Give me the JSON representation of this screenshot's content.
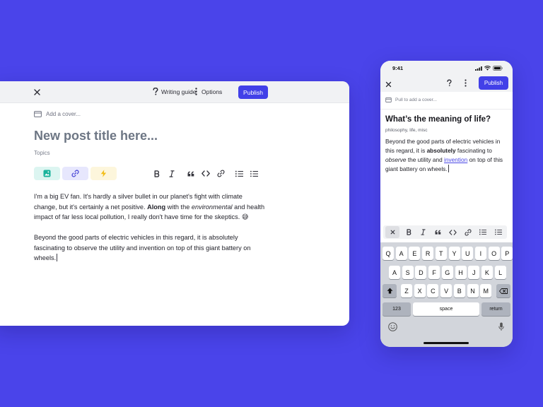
{
  "desktop": {
    "toolbar": {
      "writing_guide": "Writing guide",
      "options": "Options",
      "publish": "Publish"
    },
    "cover": "Add a cover...",
    "title_placeholder": "New post title here...",
    "topics_placeholder": "Topics",
    "insert_tools": [
      "image-icon",
      "link-icon",
      "lightning-icon"
    ],
    "format_tools": [
      "bold-icon",
      "italic-icon",
      "quote-icon",
      "code-icon",
      "link-icon",
      "ordered-list-icon",
      "bullet-list-icon"
    ],
    "body": {
      "p1_a": "I'm a big EV fan. It's hardly a silver bullet in our planet's fight with climate change, but it's certainly a net positive. ",
      "p1_bold": "Along",
      "p1_b": " with the ",
      "p1_italic": "environmental",
      "p1_c": " and health impact of far less local pollution, I really don't have time for the skeptics. ",
      "p1_emoji": "😅",
      "p2": "Beyond the good parts of electric vehicles in this regard, it is absolutely fascinating to observe the utility and invention on top of this giant battery on wheels."
    }
  },
  "phone": {
    "time": "9:41",
    "publish": "Publish",
    "cover": "Pull to add a cover...",
    "title": "What’s the meaning of life?",
    "tags": "philosophy, life, misc",
    "body": {
      "a": "Beyond the good parts of electric vehicles in this regard, it is ",
      "bold": "absolutely",
      "b": " fascinating to ",
      "italic": "observe",
      "c": " the utility and ",
      "link": "invention",
      "d": " on top of this giant battery on wheels."
    },
    "keyboard": {
      "row1": [
        "Q",
        "A",
        "E",
        "R",
        "T",
        "Y",
        "U",
        "I",
        "O",
        "P"
      ],
      "row2": [
        "A",
        "S",
        "D",
        "F",
        "G",
        "H",
        "J",
        "K",
        "L"
      ],
      "row3": [
        "Z",
        "X",
        "C",
        "V",
        "B",
        "N",
        "M"
      ],
      "numbers": "123",
      "space": "space",
      "return": "return"
    }
  },
  "colors": {
    "background": "#4a44ea",
    "accent": "#4240e8"
  }
}
